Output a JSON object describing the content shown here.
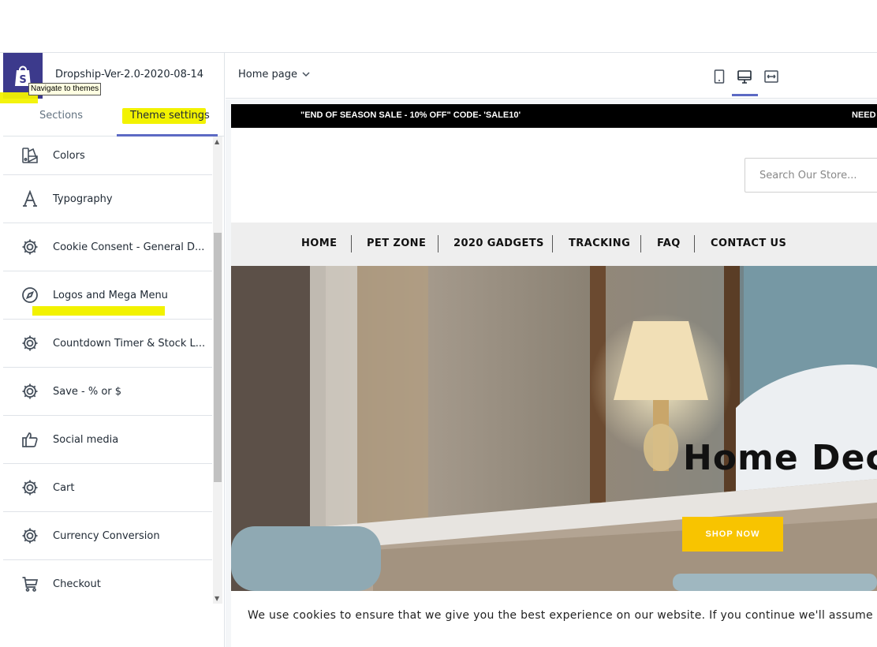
{
  "sidebar": {
    "theme_name": "Dropship-Ver-2.0-2020-08-14",
    "tooltip": "Navigate to themes",
    "tabs": [
      {
        "label": "Sections"
      },
      {
        "label": "Theme settings"
      }
    ],
    "items": [
      {
        "label": "Colors",
        "icon": "colors-icon"
      },
      {
        "label": "Typography",
        "icon": "typography-icon"
      },
      {
        "label": "Cookie Consent - General D...",
        "icon": "gear-icon"
      },
      {
        "label": "Logos and Mega Menu",
        "icon": "compass-icon"
      },
      {
        "label": "Countdown Timer & Stock L...",
        "icon": "gear-icon"
      },
      {
        "label": "Save - % or $",
        "icon": "gear-icon"
      },
      {
        "label": "Social media",
        "icon": "thumbs-up-icon"
      },
      {
        "label": "Cart",
        "icon": "gear-icon"
      },
      {
        "label": "Currency Conversion",
        "icon": "gear-icon"
      },
      {
        "label": "Checkout",
        "icon": "cart-icon"
      }
    ]
  },
  "editor": {
    "page_select": "Home page",
    "views": [
      "mobile-icon",
      "desktop-icon",
      "fullscreen-icon"
    ]
  },
  "preview": {
    "announcement": "\"END OF SEASON SALE - 10% OFF\" CODE- 'SALE10'",
    "announcement_2": "NEED",
    "search_placeholder": "Search Our Store...",
    "nav": [
      "HOME",
      "PET ZONE",
      "2020 GADGETS",
      "TRACKING",
      "FAQ",
      "CONTACT US"
    ],
    "hero_title": "Home Dec",
    "shop_button": "SHOP NOW",
    "cookie_text": "We use cookies to ensure that we give you the best experience on our website. If you continue we'll assume"
  },
  "colors": {
    "accent": "#5c6ac4",
    "logo_bg": "#3c3a8c",
    "highlight": "#f2f200",
    "shop_button": "#f8c400"
  }
}
